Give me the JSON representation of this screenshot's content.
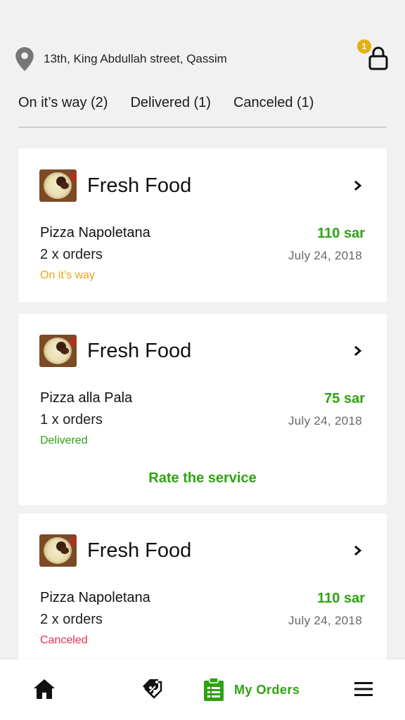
{
  "header": {
    "address": "13th, King Abdullah street, Qassim",
    "cart_badge": "1"
  },
  "tabs": [
    {
      "label": "On it’s way (2)"
    },
    {
      "label": "Delivered (1)"
    },
    {
      "label": "Canceled (1)"
    }
  ],
  "orders": [
    {
      "store": "Fresh Food",
      "item": "Pizza Napoletana",
      "qty": "2 x orders",
      "price": "110 sar",
      "date": "July 24, 2018",
      "status": "On it’s way",
      "status_color": "#e5a51c"
    },
    {
      "store": "Fresh Food",
      "item": "Pizza alla Pala",
      "qty": "1 x orders",
      "price": "75 sar",
      "date": "July 24, 2018",
      "status": "Delivered",
      "status_color": "#2ea310",
      "action": "Rate the service"
    },
    {
      "store": "Fresh Food",
      "item": "Pizza Napoletana",
      "qty": "2 x orders",
      "price": "110 sar",
      "date": "July 24, 2018",
      "status": "Canceled",
      "status_color": "#e8304f"
    }
  ],
  "bottom_nav": {
    "active_label": "My Orders",
    "icons": [
      "home-icon",
      "offers-tag-icon",
      "orders-clipboard-icon",
      "menu-icon"
    ],
    "accent": "#2ea310"
  }
}
